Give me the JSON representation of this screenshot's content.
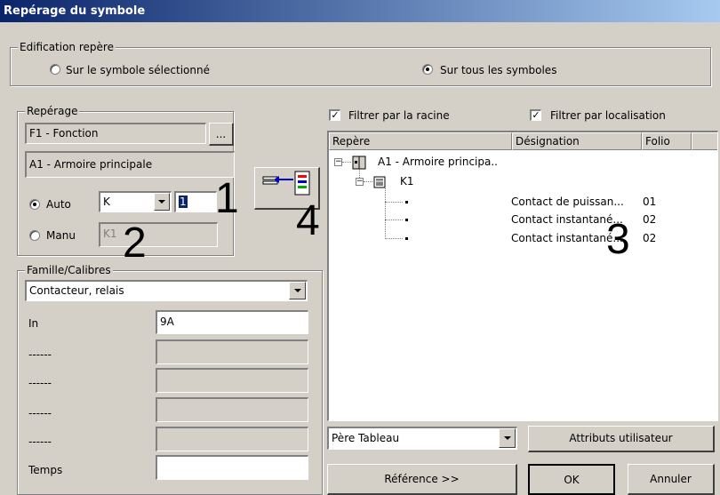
{
  "window": {
    "title": "Repérage du symbole"
  },
  "edition": {
    "legend": "Edification repère",
    "option_selected": "Sur le symbole sélectionné",
    "option_all": "Sur tous les symboles",
    "selected": "all"
  },
  "reperage": {
    "legend": "Repérage",
    "fonction": "F1 - Fonction",
    "browse_label": "...",
    "localisation": "A1 - Armoire principale",
    "auto_label": "Auto",
    "auto_letter": "K",
    "auto_number": "1",
    "manu_label": "Manu",
    "manu_value": "K1",
    "mode": "auto"
  },
  "famille": {
    "legend": "Famille/Calibres",
    "selected": "Contacteur, relais",
    "rows": [
      {
        "label": "In",
        "value": "9A"
      },
      {
        "label": "------",
        "value": ""
      },
      {
        "label": "------",
        "value": ""
      },
      {
        "label": "------",
        "value": ""
      },
      {
        "label": "------",
        "value": ""
      },
      {
        "label": "Temps",
        "value": ""
      }
    ]
  },
  "filters": {
    "racine_label": "Filtrer par la racine",
    "racine_checked": true,
    "localisation_label": "Filtrer par localisation",
    "localisation_checked": true
  },
  "tree": {
    "columns": [
      "Repère",
      "Désignation",
      "Folio"
    ],
    "root_label": "A1 - Armoire principa..",
    "child_label": "K1",
    "leaves": [
      {
        "designation": "Contact de puissan...",
        "folio": "01"
      },
      {
        "designation": "Contact instantané...",
        "folio": "02"
      },
      {
        "designation": "Contact instantané...",
        "folio": "02"
      }
    ]
  },
  "bottom": {
    "combo_value": "Père Tableau",
    "attributs_label": "Attributs utilisateur",
    "reference_label": "Référence >>",
    "ok_label": "OK",
    "annuler_label": "Annuler"
  },
  "annotations": [
    "1",
    "2",
    "3",
    "4"
  ],
  "icons": {
    "transfer_button": "transfer-to-list-icon",
    "tree_root": "cabinet-icon",
    "tree_child": "relay-icon"
  },
  "colors": {
    "titlebar_start": "#0a246a",
    "titlebar_end": "#a6caf0",
    "face": "#d4d0c8"
  }
}
